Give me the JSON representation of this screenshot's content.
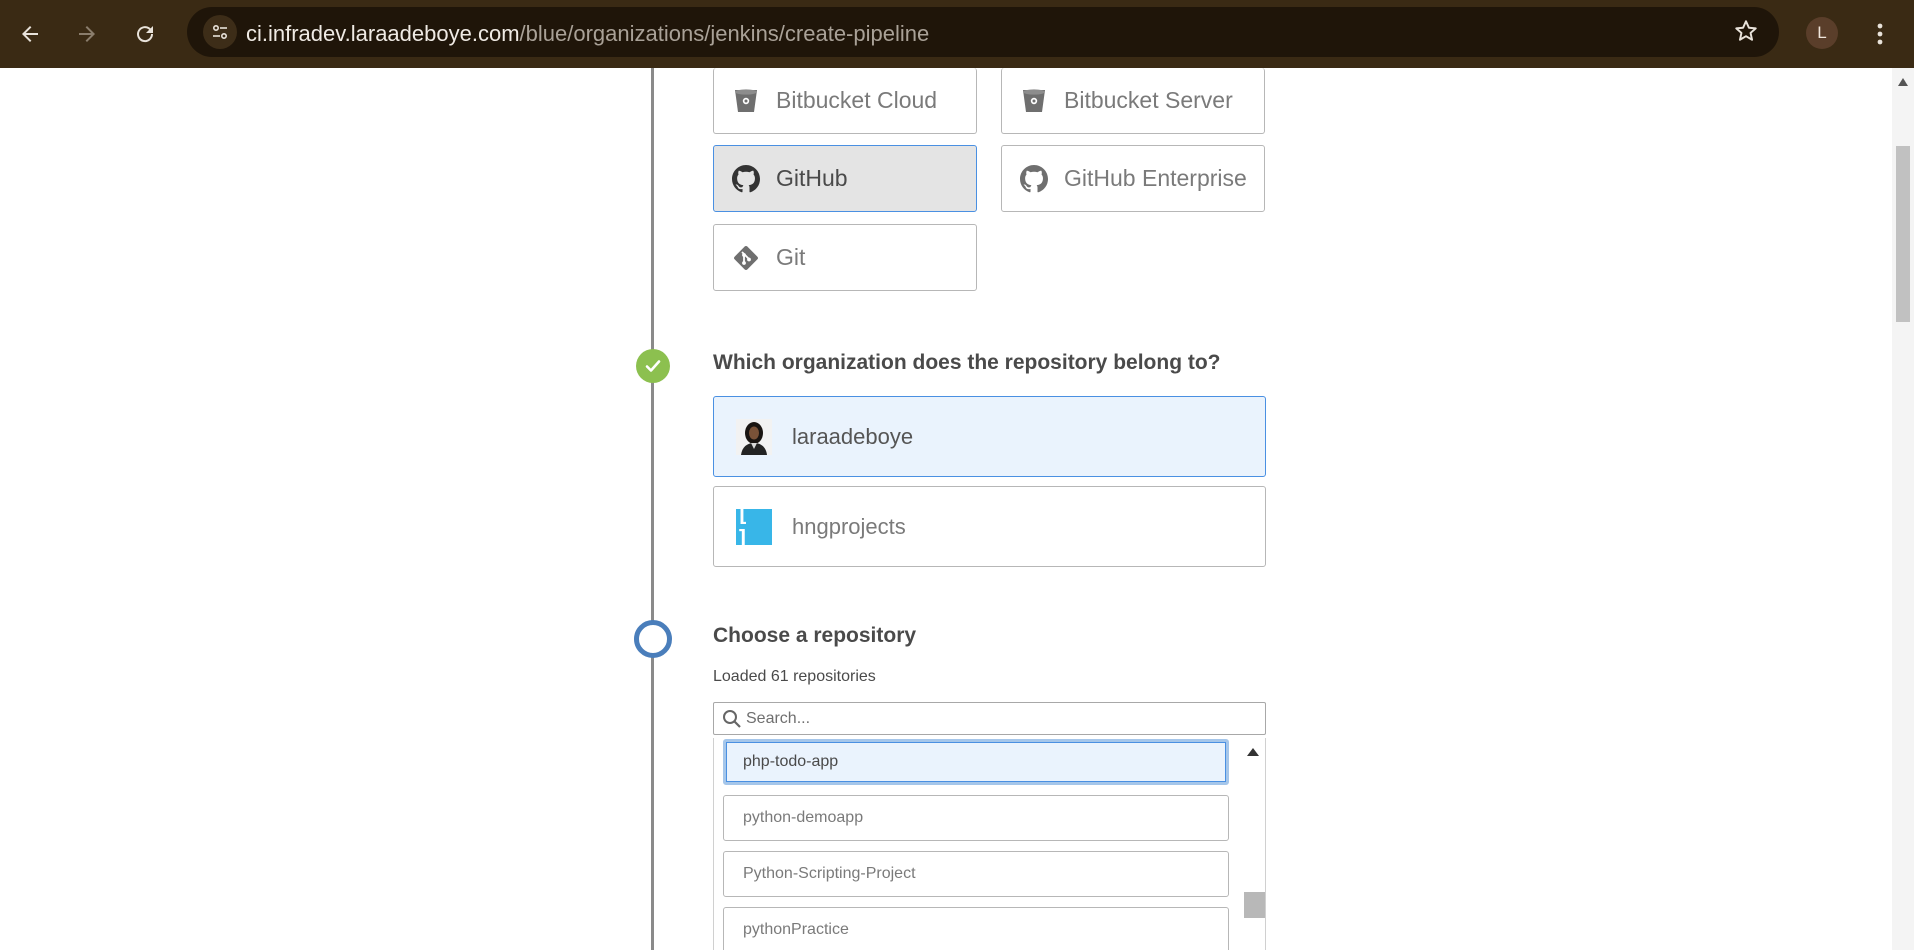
{
  "browser": {
    "url_host": "ci.infradev.laraadeboye.com",
    "url_path": "/blue/organizations/jenkins/create-pipeline",
    "profile_initial": "L",
    "icons": [
      "back-icon",
      "forward-icon",
      "reload-icon",
      "site-info-icon",
      "bookmark-star-icon",
      "menu-kebab-icon"
    ]
  },
  "providers": [
    {
      "label": "Bitbucket Cloud",
      "icon": "bitbucket-icon",
      "selected": false
    },
    {
      "label": "Bitbucket Server",
      "icon": "bitbucket-icon",
      "selected": false
    },
    {
      "label": "GitHub",
      "icon": "github-icon",
      "selected": true
    },
    {
      "label": "GitHub Enterprise",
      "icon": "github-icon",
      "selected": false
    },
    {
      "label": "Git",
      "icon": "git-icon",
      "selected": false
    }
  ],
  "org_step": {
    "heading": "Which organization does the repository belong to?",
    "status": "complete",
    "orgs": [
      {
        "name": "laraadeboye",
        "selected": true
      },
      {
        "name": "hngprojects",
        "selected": false,
        "logo_text": "[ ]"
      }
    ]
  },
  "repo_step": {
    "heading": "Choose a repository",
    "status": "active",
    "loaded_text": "Loaded 61 repositories",
    "search_placeholder": "Search...",
    "repos": [
      {
        "name": "php-todo-app",
        "selected": true
      },
      {
        "name": "python-demoapp",
        "selected": false
      },
      {
        "name": "Python-Scripting-Project",
        "selected": false
      },
      {
        "name": "pythonPractice",
        "selected": false
      }
    ]
  },
  "colors": {
    "chrome_bg": "#3a2a14",
    "accent_blue": "#4a90e2",
    "step_complete": "#8cc04f",
    "step_active": "#4a7ebb",
    "hng_logo": "#38b6e8"
  }
}
